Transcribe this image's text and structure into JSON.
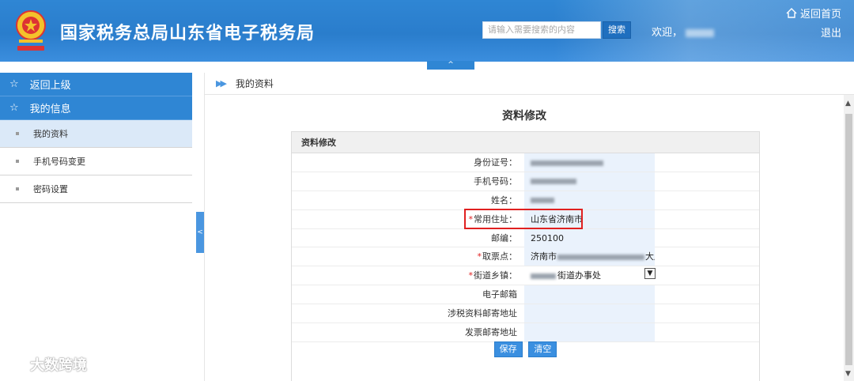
{
  "header": {
    "site_title": "国家税务总局山东省电子税务局",
    "search_placeholder": "请输入需要搜索的内容",
    "search_button": "搜索",
    "welcome": "欢迎，",
    "home_link": "返回首页",
    "logout": "退出",
    "collapse_symbol": "^"
  },
  "sidebar": {
    "back": "返回上级",
    "section": "我的信息",
    "items": [
      {
        "label": "我的资料",
        "active": true
      },
      {
        "label": "手机号码变更",
        "active": false
      },
      {
        "label": "密码设置",
        "active": false
      }
    ],
    "toggle_symbol": "<"
  },
  "breadcrumb": {
    "current": "我的资料"
  },
  "form": {
    "title": "资料修改",
    "panel_title": "资料修改",
    "fields": [
      {
        "label": "身份证号：",
        "required": false,
        "value": ""
      },
      {
        "label": "手机号码：",
        "required": false,
        "value": ""
      },
      {
        "label": "姓名：",
        "required": false,
        "value": ""
      },
      {
        "label": "常用住址：",
        "required": true,
        "value": "山东省济南市"
      },
      {
        "label": "邮编：",
        "required": false,
        "value": "250100"
      },
      {
        "label": "取票点：",
        "required": true,
        "value_prefix": "济南市",
        "value_suffix": "大厅"
      },
      {
        "label": "街道乡镇：",
        "required": true,
        "value_suffix": "街道办事处"
      },
      {
        "label": "电子邮箱",
        "required": false,
        "value": ""
      },
      {
        "label": "涉税资料邮寄地址",
        "required": false,
        "value": ""
      },
      {
        "label": "发票邮寄地址",
        "required": false,
        "value": ""
      }
    ],
    "save_button": "保存",
    "clear_button": "清空"
  },
  "watermark": {
    "text": "大数跨境"
  },
  "colors": {
    "header_blue": "#2f86d4",
    "highlight_red": "#e02020",
    "field_bg": "#eaf2fc"
  }
}
